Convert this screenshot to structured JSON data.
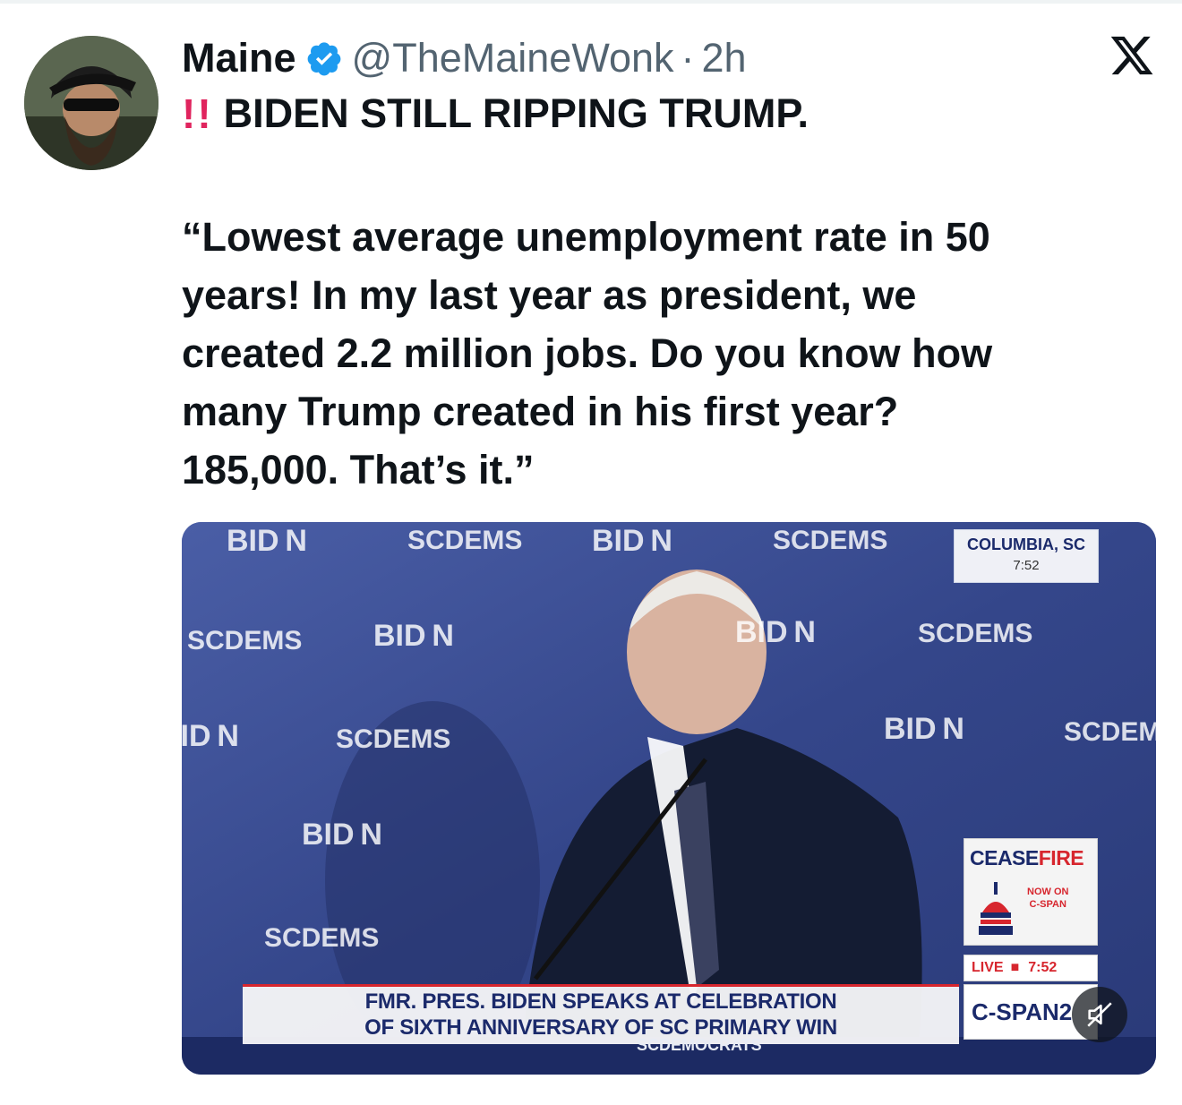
{
  "author": {
    "display_name": "Maine",
    "handle": "@TheMaineWonk",
    "separator": "·",
    "time": "2h",
    "avatar_icon": "bearded-man-avatar"
  },
  "headline": {
    "emoji": "!!",
    "text": "BIDEN STILL RIPPING TRUMP."
  },
  "body": {
    "lines": [
      "“Lowest average unemployment rate in 50",
      "years! In my last year as president, we",
      "created 2.2 million jobs. Do you know how",
      "many Trump created in his first year?",
      "185,000. That’s it.”"
    ]
  },
  "media": {
    "backdrop_words": {
      "biden": "BID N",
      "scdems": "SCDEMS"
    },
    "location": {
      "city": "COLUMBIA, SC",
      "clock": "7:52"
    },
    "ceasefire": {
      "word1": "CEASE",
      "word2": "FIRE",
      "nowon_line1": "NOW ON",
      "nowon_line2": "C-SPAN"
    },
    "live": {
      "label": "LIVE",
      "clock": "7:52"
    },
    "network": "C-SPAN2",
    "chyron": {
      "line1": "FMR. PRES. BIDEN SPEAKS AT CELEBRATION",
      "line2": "OF SIXTH ANNIVERSARY OF SC PRIMARY WIN"
    },
    "podium_label": "SCDEMOCRATS"
  },
  "colors": {
    "verified_blue": "#1d9bf0",
    "accent_red": "#e0245e",
    "backdrop_blue": "#3b4c8f",
    "cspan_navy": "#1b2a6b"
  }
}
